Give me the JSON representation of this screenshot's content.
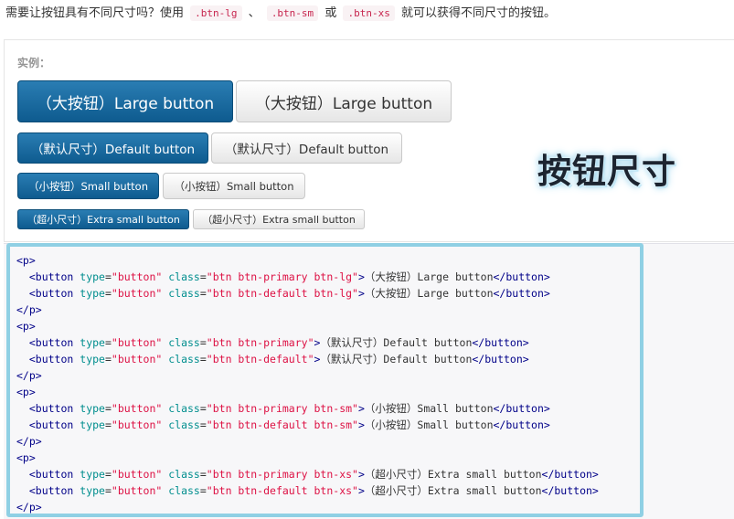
{
  "intro": {
    "prefix": "需要让按钮具有不同尺寸吗？使用",
    "code1": ".btn-lg",
    "sep1": "、",
    "code2": ".btn-sm",
    "sep2": "或",
    "code3": ".btn-xs",
    "suffix": "就可以获得不同尺寸的按钮。"
  },
  "example": {
    "label": "实例：",
    "buttons": {
      "lg_primary": "（大按钮）Large button",
      "lg_default": "（大按钮）Large button",
      "md_primary": "（默认尺寸）Default button",
      "md_default": "（默认尺寸）Default button",
      "sm_primary": "（小按钮）Small button",
      "sm_default": "（小按钮）Small button",
      "xs_primary": "（超小尺寸）Extra small button",
      "xs_default": "（超小尺寸）Extra small button"
    },
    "watermark": "按钮尺寸"
  },
  "code": {
    "p_open": "<p>",
    "p_close": "</p>",
    "btn_open": "<button",
    "btn_close": "</button>",
    "attr_type": "type",
    "attr_class": "class",
    "eq": "=",
    "val_button": "\"button\"",
    "gt": ">",
    "classes": {
      "primary_lg": "\"btn btn-primary btn-lg\"",
      "default_lg": "\"btn btn-default btn-lg\"",
      "primary": "\"btn btn-primary\"",
      "default": "\"btn btn-default\"",
      "primary_sm": "\"btn btn-primary btn-sm\"",
      "default_sm": "\"btn btn-default btn-sm\"",
      "primary_xs": "\"btn btn-primary btn-xs\"",
      "default_xs": "\"btn btn-default btn-xs\""
    },
    "texts": {
      "lg": "（大按钮）Large button",
      "md": "（默认尺寸）Default button",
      "sm": "（小按钮）Small button",
      "xs": "（超小尺寸）Extra small button"
    }
  }
}
